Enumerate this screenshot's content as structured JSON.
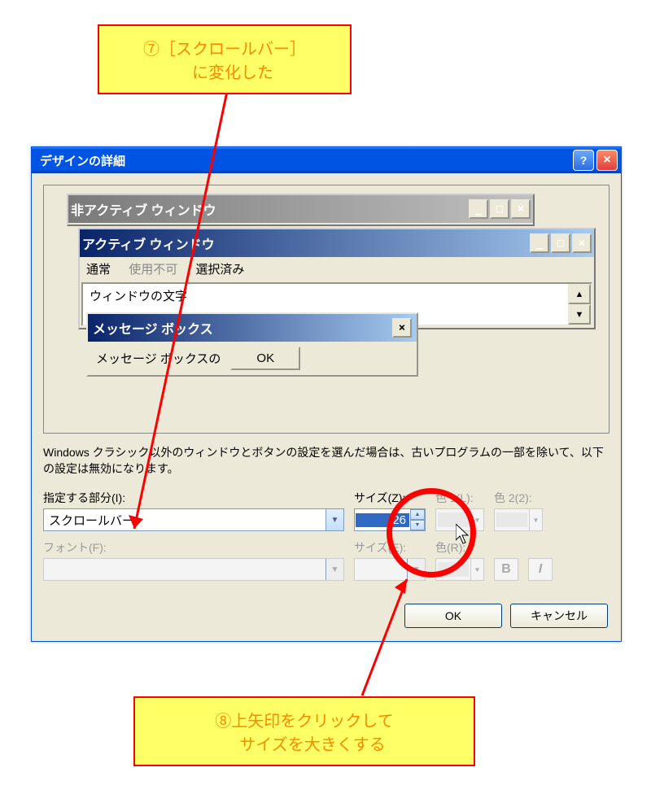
{
  "callouts": {
    "top": "⑦［スクロールバー］\n　に変化した",
    "bottom": "⑧上矢印をクリックして\n　サイズを大きくする"
  },
  "dialog": {
    "title": "デザインの詳細",
    "help": "?",
    "close": "×"
  },
  "preview": {
    "inactive_title": "非アクティブ ウィンドウ",
    "active_title": "アクティブ ウィンドウ",
    "menu_normal": "通常",
    "menu_disabled": "使用不可",
    "menu_selected": "選択済み",
    "content_text": "ウィンドウの文字",
    "msgbox_title": "メッセージ ボックス",
    "msgbox_text": "メッセージ ボックスの",
    "msgbox_ok": "OK"
  },
  "note": "Windows クラシック以外のウィンドウとボタンの設定を選んだ場合は、古いプログラムの一部を除いて、以下の設定は無効になります。",
  "fields": {
    "item_label": "指定する部分(I):",
    "item_value": "スクロールバー",
    "size_label": "サイズ(Z):",
    "size_value": "26",
    "color1_label": "色 1(L):",
    "color2_label": "色 2(2):",
    "font_label": "フォント(F):",
    "font_size_label": "サイズ(E):",
    "font_color_label": "色(R):"
  },
  "buttons": {
    "ok": "OK",
    "cancel": "キャンセル",
    "bold": "B",
    "italic": "I"
  },
  "glyphs": {
    "minimize": "_",
    "maximize": "□",
    "close": "×",
    "dropdown": "▼",
    "up": "▲",
    "down": "▼"
  }
}
